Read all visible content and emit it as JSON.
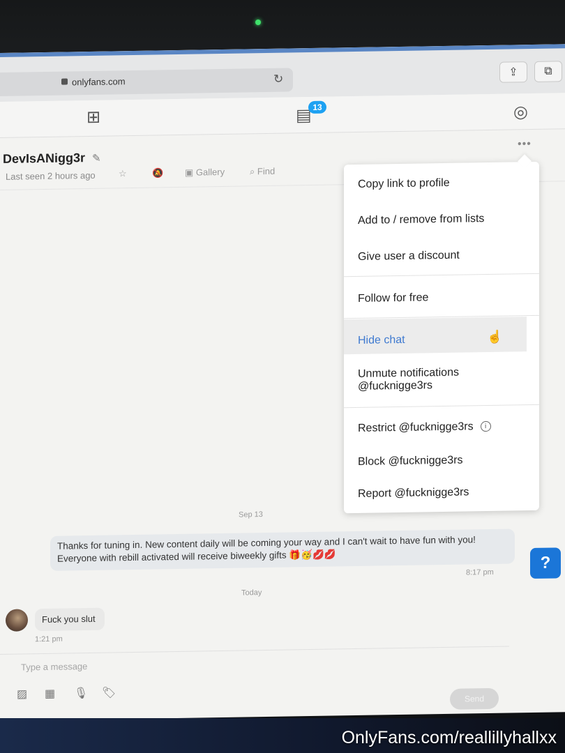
{
  "browser": {
    "url": "onlyfans.com"
  },
  "nav": {
    "messages_badge": "13"
  },
  "chat": {
    "name": "DevIsANigg3r",
    "last_seen": "Last seen 2 hours ago",
    "actions": {
      "gallery": "Gallery",
      "find": "Find"
    }
  },
  "menu": {
    "items": [
      "Copy link to profile",
      "Add to / remove from lists",
      "Give user a discount",
      "Follow for free",
      "Hide chat",
      "Unmute notifications",
      "@fucknigge3rs",
      "Restrict @fucknigge3rs",
      "Block @fucknigge3rs",
      "Report @fucknigge3rs"
    ]
  },
  "messages": {
    "date_1": "Sep 13",
    "outgoing_text": "Thanks for tuning in. New content daily will be coming your way and I can't wait to have fun with you! Everyone with rebill activated will receive biweekly gifts 🎁🥳💋💋",
    "outgoing_time": "8:17 pm",
    "date_2": "Today",
    "incoming_text": "Fuck you slut",
    "incoming_time": "1:21 pm"
  },
  "composer": {
    "placeholder": "Type a message",
    "send_label": "Send"
  },
  "watermark": "OnlyFans.com/reallillyhallxx"
}
